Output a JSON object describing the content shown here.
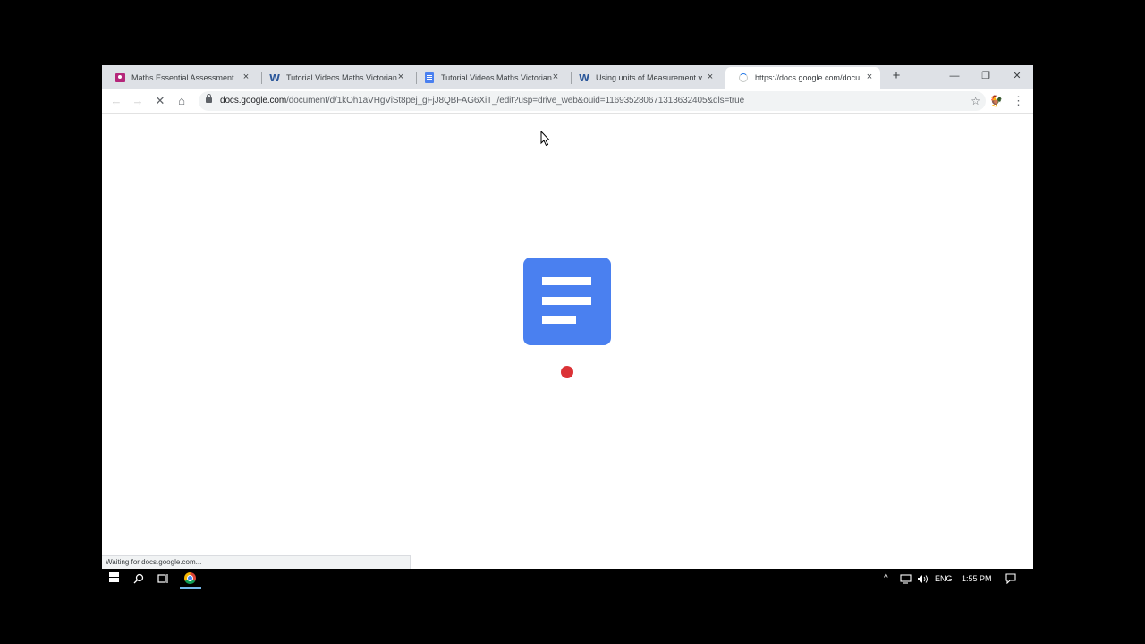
{
  "browser": {
    "tabs": [
      {
        "title": "Maths Essential Assessment",
        "favicon": "classroom-icon",
        "close": "×"
      },
      {
        "title": "Tutorial Videos Maths Victorian",
        "favicon": "word-icon",
        "favicon_glyph": "W",
        "close": "×"
      },
      {
        "title": "Tutorial Videos Maths Victorian",
        "favicon": "docs-icon",
        "close": "×"
      },
      {
        "title": "Using units of Measurement v",
        "favicon": "word-icon",
        "favicon_glyph": "W",
        "close": "×"
      },
      {
        "title": "https://docs.google.com/docu",
        "favicon": "loading-spinner",
        "close": "×",
        "active": true
      }
    ],
    "new_tab": "+",
    "window_controls": {
      "minimize": "—",
      "restore": "❐",
      "close": "✕"
    },
    "nav": {
      "back": "←",
      "forward": "→",
      "stop": "✕",
      "home": "⌂"
    },
    "address": {
      "host": "docs.google.com",
      "path": "/document/d/1kOh1aVHgViSt8pej_gFjJ8QBFAG6XiT_/edit?usp=drive_web&ouid=116935280671313632405&dls=true"
    },
    "bookmark_star": "☆",
    "extension_icon": "🐓",
    "menu": "⋮"
  },
  "page": {
    "status_text": "Waiting for docs.google.com...",
    "logo": "google-docs-icon",
    "loader_color": "#db3236",
    "logo_color": "#4a80f0"
  },
  "taskbar": {
    "tray_chevron": "^",
    "language": "ENG",
    "time": "1:55 PM"
  }
}
